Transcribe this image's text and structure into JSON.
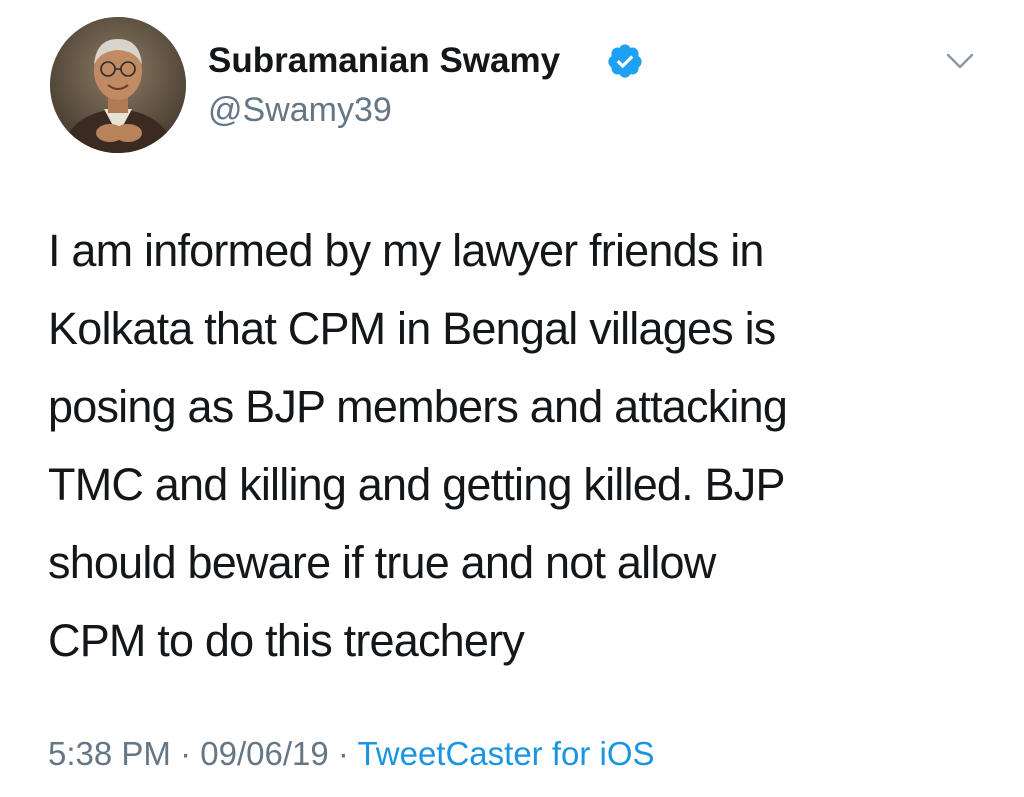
{
  "author": {
    "name": "Subramanian Swamy",
    "handle": "@Swamy39",
    "verified": true,
    "avatar_icon": "profile-photo"
  },
  "menu": {
    "icon": "chevron-down-icon"
  },
  "tweet": {
    "lines": [
      "I am informed by my lawyer friends in",
      "Kolkata that CPM in Bengal villages is",
      "posing as BJP members and attacking",
      "TMC and killing and getting killed. BJP",
      "should beware if true and not allow",
      "CPM to do this treachery"
    ]
  },
  "meta": {
    "time": "5:38 PM",
    "separator1": " · ",
    "date": "09/06/19",
    "separator2": " · ",
    "source": "TweetCaster for iOS"
  },
  "colors": {
    "verified_blue": "#1da1f2",
    "link_blue": "#1b95e0",
    "secondary_text": "#657786",
    "primary_text": "#14171a"
  }
}
